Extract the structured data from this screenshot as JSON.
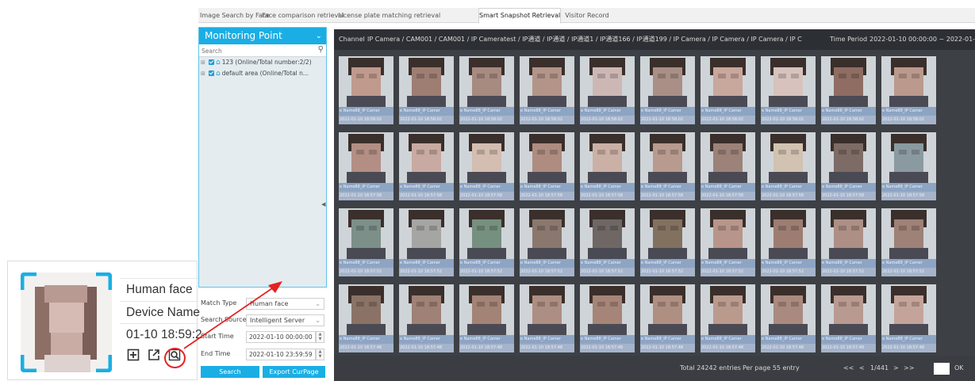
{
  "tabs": [
    {
      "label": "Image Search by Face",
      "active": false
    },
    {
      "label": "Face comparison retrieval",
      "active": false
    },
    {
      "label": "License plate matching retrieval",
      "active": false
    },
    {
      "label": "Smart Snapshot Retrieval",
      "active": true
    },
    {
      "label": "Visitor Record",
      "active": false
    }
  ],
  "monitoring": {
    "title": "Monitoring Point",
    "search_placeholder": "Search",
    "tree": [
      {
        "label": "123 (Online/Total number:2/2)"
      },
      {
        "label": "default area (Online/Total n..."
      }
    ]
  },
  "filters": {
    "match_type_label": "Match Type",
    "match_type_value": "Human face",
    "search_source_label": "Search Source",
    "search_source_value": "Intelligent Server",
    "start_time_label": "Start Time",
    "start_time_value": "2022-01-10 00:00:00",
    "end_time_label": "End Time",
    "end_time_value": "2022-01-10 23:59:59",
    "search_button": "Search",
    "export_button": "Export CurPage"
  },
  "results": {
    "channel_label": "Channel",
    "channel_value": "IP Camera / CAM001 / CAM001 / IP Cameratest / IP通道 / IP通道 / IP通道1 / IP通道166 / IP通道199 / IP Camera / IP Camera / IP Camera / IP C",
    "time_period_label": "Time Period",
    "time_period_value": "2022-01-10 00:00:00 ~ 2022-01-10 2",
    "rows": [
      {
        "time": "2022-01-10 18:58:02",
        "tones": [
          "#c09a8c",
          "#9e7e73",
          "#a78a80",
          "#b39488",
          "#cdb7b5",
          "#a98f86",
          "#c8a79c",
          "#d7c2bd",
          "#8f6d63",
          "#bb998d"
        ]
      },
      {
        "time": "2022-01-10 18:57:58",
        "tones": [
          "#b38e84",
          "#c9aaa2",
          "#d4bdb1",
          "#ae8c80",
          "#cbb0a6",
          "#b89a8f",
          "#9c8279",
          "#d2c2b1",
          "#7d6b66",
          "#8a9aa0"
        ]
      },
      {
        "time": "2022-01-10 18:57:52",
        "tones": [
          "#7c8f88",
          "#a5a6a4",
          "#76907f",
          "#8a786e",
          "#6e6764",
          "#82715f",
          "#b8958a",
          "#9d7d72",
          "#ad8f85",
          "#9e8177"
        ]
      },
      {
        "time": "2022-01-10 18:57:48",
        "tones": [
          "#8a7366",
          "#9f8176",
          "#a38376",
          "#ad8e82",
          "#a68578",
          "#b08f83",
          "#bb9a8e",
          "#aa8a7f",
          "#b99a90",
          "#c4a49a"
        ]
      }
    ],
    "name_caption": "e Name88_IP Camer",
    "total_text": "Total 24242 entries",
    "per_page_text": "Per page 55 entry",
    "first": "<<",
    "prev": "<",
    "page_text": "1/441",
    "next": ">",
    "last": ">>",
    "ok": "OK"
  },
  "inset": {
    "type_text": "Human face",
    "device_text": "Device Name",
    "time_text": "01-10 18:59:2",
    "icons": [
      "add-icon",
      "open-external-icon",
      "search-image-icon"
    ]
  }
}
